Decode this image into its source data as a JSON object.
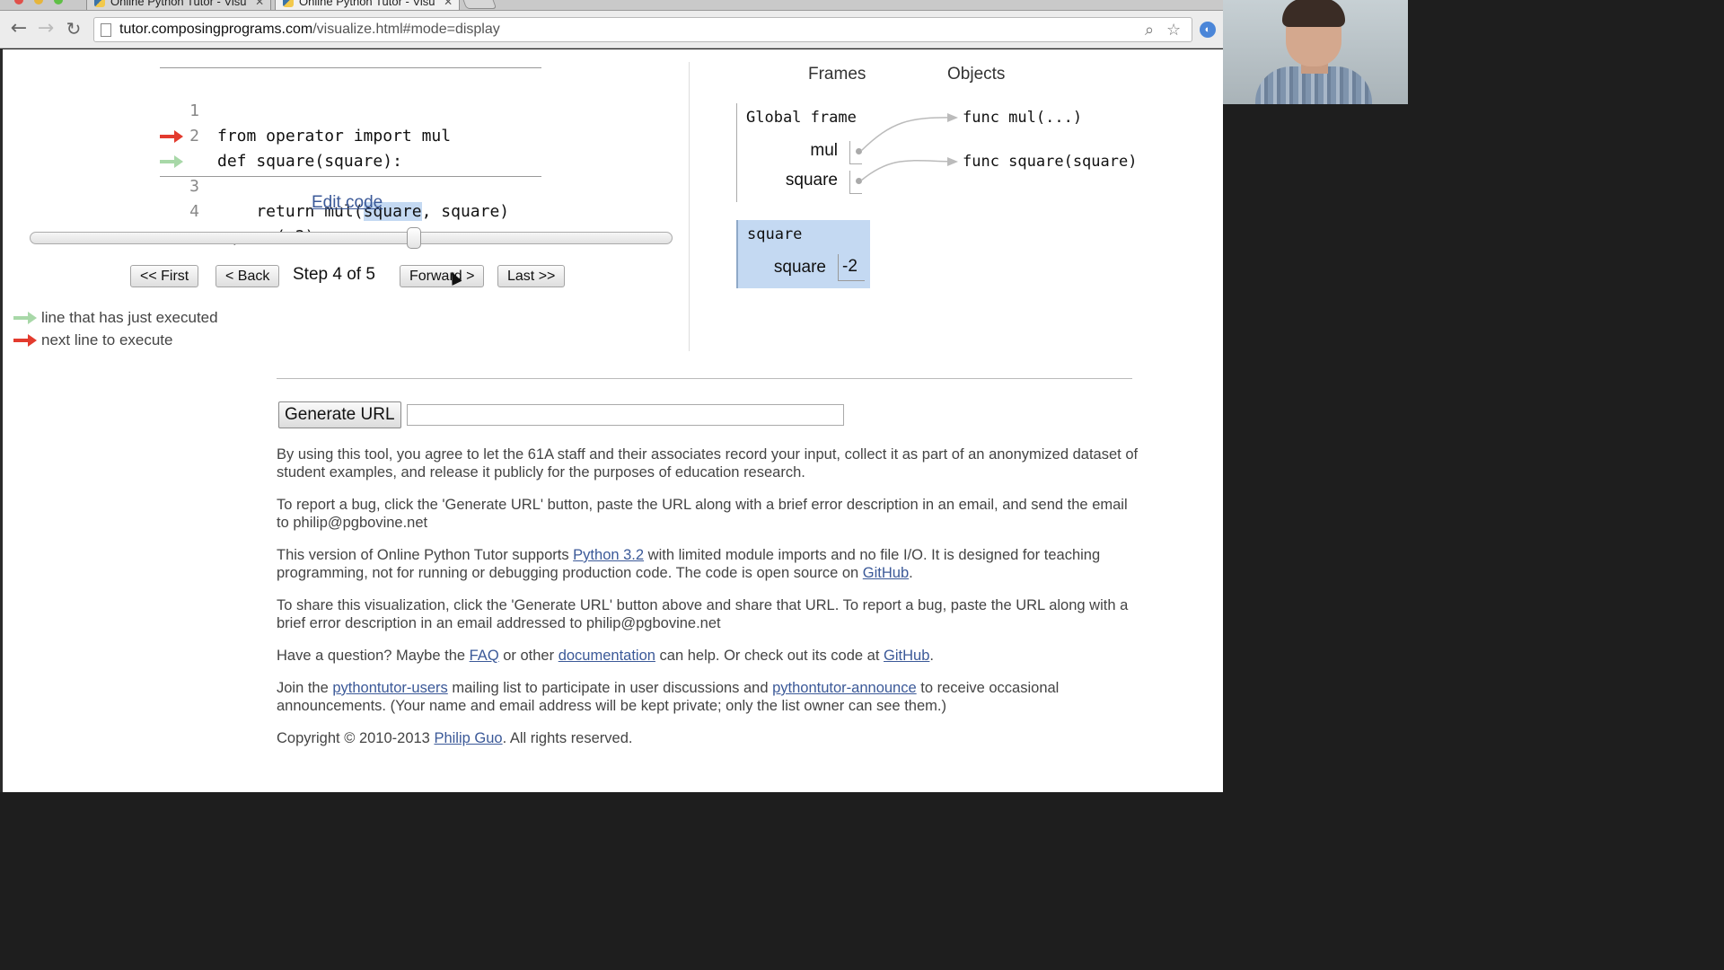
{
  "browser": {
    "tabs": [
      {
        "title": "Online Python Tutor - Visu",
        "active": false
      },
      {
        "title": "Online Python Tutor - Visu",
        "active": true
      }
    ],
    "url_host": "tutor.composingprograms.com",
    "url_path": "/visualize.html#mode=display",
    "close_glyph": "✕"
  },
  "code": {
    "lines": [
      {
        "num": "1",
        "pre": "from operator import mul",
        "hl": "",
        "post": "",
        "marker": "none"
      },
      {
        "num": "2",
        "pre": "def square(square):",
        "hl": "",
        "post": "",
        "marker": "none"
      },
      {
        "num": "3",
        "pre": "    return mul(",
        "hl": "square",
        "post": ", square)",
        "marker": "next"
      },
      {
        "num": "4",
        "pre": "square(-2)",
        "hl": "",
        "post": "",
        "marker": "executed"
      }
    ],
    "edit_link": "Edit code"
  },
  "nav": {
    "first": "<< First",
    "back": "< Back",
    "step_label": "Step 4 of 5",
    "forward": "Forward >",
    "last": "Last >>",
    "step_current": 4,
    "step_total": 5
  },
  "legend": {
    "executed": "line that has just executed",
    "next": "next line to execute",
    "executed_color": "#a8d8a8",
    "next_color": "#e33b2e"
  },
  "viz": {
    "frames_header": "Frames",
    "objects_header": "Objects",
    "global_frame": {
      "label": "Global frame",
      "vars": [
        "mul",
        "square"
      ]
    },
    "objects": [
      "func mul(...)",
      "func square(square)"
    ],
    "active_frame": {
      "label": "square",
      "var": "square",
      "value": "-2",
      "color": "#c4d9f2"
    }
  },
  "share": {
    "button": "Generate URL",
    "url_value": ""
  },
  "info": {
    "p1": "By using this tool, you agree to let the 61A staff and their associates record your input, collect it as part of an anonymized dataset of student examples, and release it publicly for the purposes of education research.",
    "p2": "To report a bug, click the 'Generate URL' button, paste the URL along with a brief error description in an email, and send the email to philip@pgbovine.net",
    "p3_a": "This version of Online Python Tutor supports ",
    "p3_link1": "Python 3.2",
    "p3_b": " with limited module imports and no file I/O. It is designed for teaching programming, not for running or debugging production code. The code is open source on ",
    "p3_link2": "GitHub",
    "p3_c": ".",
    "p4": "To share this visualization, click the 'Generate URL' button above and share that URL. To report a bug, paste the URL along with a brief error description in an email addressed to philip@pgbovine.net",
    "p5_a": "Have a question? Maybe the ",
    "p5_link1": "FAQ",
    "p5_b": " or other ",
    "p5_link2": "documentation",
    "p5_c": " can help. Or check out its code at ",
    "p5_link3": "GitHub",
    "p5_d": ".",
    "p6_a": "Join the ",
    "p6_link1": "pythontutor-users",
    "p6_b": " mailing list to participate in user discussions and ",
    "p6_link2": "pythontutor-announce",
    "p6_c": " to receive occasional announcements. (Your name and email address will be kept private; only the list owner can see them.)",
    "p7_a": "Copyright © 2010-2013 ",
    "p7_link": "Philip Guo",
    "p7_b": ". All rights reserved."
  }
}
